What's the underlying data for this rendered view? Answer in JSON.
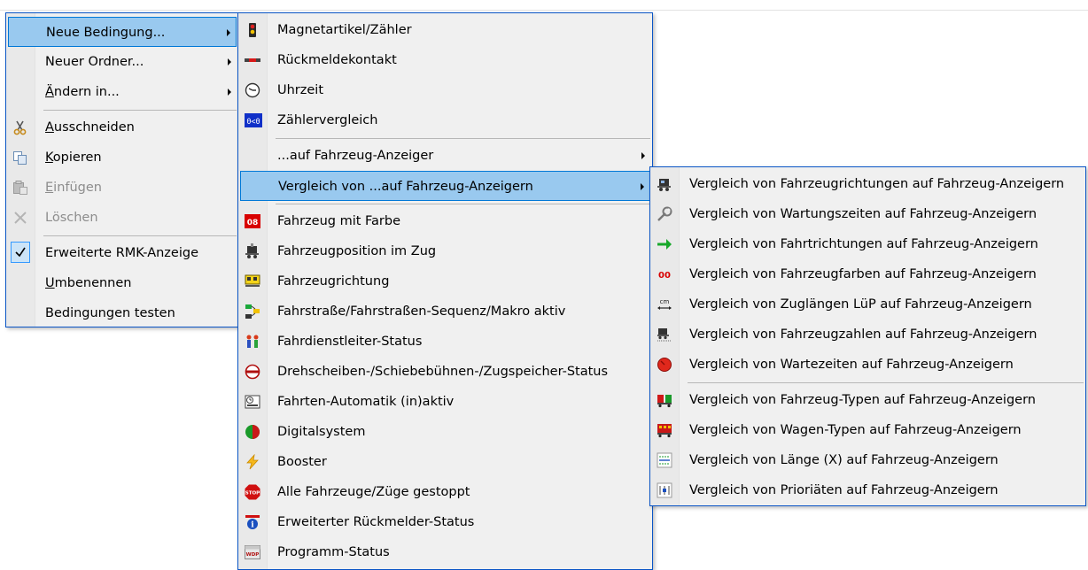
{
  "menu1": {
    "items": [
      {
        "pre": "",
        "u": "",
        "post": "Neue Bedingung...",
        "icon": "",
        "submenu": true
      },
      {
        "pre": "",
        "u": "",
        "post": "Neuer Ordner...",
        "icon": "",
        "submenu": true
      },
      {
        "pre": "",
        "u": "Ä",
        "post": "ndern in...",
        "icon": "",
        "submenu": true
      },
      {
        "pre": "",
        "u": "A",
        "post": "usschneiden",
        "icon": "scissors-icon"
      },
      {
        "pre": "",
        "u": "K",
        "post": "opieren",
        "icon": "copy-icon"
      },
      {
        "pre": "",
        "u": "E",
        "post": "infügen",
        "icon": "paste-icon",
        "disabled": true
      },
      {
        "pre": "",
        "u": "",
        "post": "Löschen",
        "icon": "delete-icon",
        "disabled": true
      },
      {
        "pre": "",
        "u": "",
        "post": "Erweiterte RMK-Anzeige",
        "icon": "checkmark-icon",
        "checked": true
      },
      {
        "pre": "",
        "u": "U",
        "post": "mbenennen",
        "icon": ""
      },
      {
        "pre": "",
        "u": "",
        "post": "Bedingungen testen",
        "icon": ""
      }
    ]
  },
  "menu2": {
    "items": [
      {
        "label": "Magnetartikel/Zähler",
        "icon": "signal-icon"
      },
      {
        "label": "Rückmeldekontakt",
        "icon": "feedback-contact-icon"
      },
      {
        "label": "Uhrzeit",
        "icon": "clock-icon"
      },
      {
        "label": "Zählervergleich",
        "icon": "counter-compare-icon"
      },
      {
        "label": "...auf Fahrzeug-Anzeiger",
        "icon": "",
        "submenu": true
      },
      {
        "label": "Vergleich von ...auf Fahrzeug-Anzeigern",
        "icon": "",
        "submenu": true
      },
      {
        "label": "Fahrzeug mit Farbe",
        "icon": "vehicle-color-icon"
      },
      {
        "label": "Fahrzeugposition im Zug",
        "icon": "vehicle-position-icon"
      },
      {
        "label": "Fahrzeugrichtung",
        "icon": "vehicle-direction-icon"
      },
      {
        "label": "Fahrstraße/Fahrstraßen-Sequenz/Makro aktiv",
        "icon": "route-icon"
      },
      {
        "label": "Fahrdienstleiter-Status",
        "icon": "dispatcher-icon"
      },
      {
        "label": "Drehscheiben-/Schiebebühnen-/Zugspeicher-Status",
        "icon": "turntable-icon"
      },
      {
        "label": "Fahrten-Automatik (in)aktiv",
        "icon": "schedule-icon"
      },
      {
        "label": "Digitalsystem",
        "icon": "digital-system-icon"
      },
      {
        "label": "Booster",
        "icon": "booster-icon"
      },
      {
        "label": "Alle Fahrzeuge/Züge gestoppt",
        "icon": "stop-icon"
      },
      {
        "label": "Erweiterter Rückmelder-Status",
        "icon": "info-icon"
      },
      {
        "label": "Programm-Status",
        "icon": "program-status-icon"
      }
    ]
  },
  "menu3": {
    "items": [
      {
        "label": "Vergleich von Fahrzeugrichtungen auf Fahrzeug-Anzeigern",
        "icon": "locomotive-direction-icon"
      },
      {
        "label": "Vergleich von Wartungszeiten auf Fahrzeug-Anzeigern",
        "icon": "wrench-icon"
      },
      {
        "label": "Vergleich von Fahrtrichtungen auf Fahrzeug-Anzeigern",
        "icon": "green-arrow-icon"
      },
      {
        "label": "Vergleich von Fahrzeugfarben auf Fahrzeug-Anzeigern",
        "icon": "color-00-icon"
      },
      {
        "label": "Vergleich von Zuglängen LüP auf Fahrzeug-Anzeigern",
        "icon": "length-cm-icon"
      },
      {
        "label": "Vergleich von Fahrzeugzahlen auf Fahrzeug-Anzeigern",
        "icon": "vehicle-count-icon"
      },
      {
        "label": "Vergleich von Wartezeiten auf Fahrzeug-Anzeigern",
        "icon": "wait-time-icon"
      },
      {
        "label": "Vergleich von Fahrzeug-Typen auf Fahrzeug-Anzeigern",
        "icon": "vehicle-type-icon"
      },
      {
        "label": "Vergleich von Wagen-Typen auf Fahrzeug-Anzeigern",
        "icon": "wagon-type-icon"
      },
      {
        "label": "Vergleich von Länge (X) auf Fahrzeug-Anzeigern",
        "icon": "length-x-icon"
      },
      {
        "label": "Vergleich von Prioriäten auf Fahrzeug-Anzeigern",
        "icon": "priority-icon"
      }
    ]
  },
  "icon_glyphs": {
    "counter_compare": "0<0",
    "vehicle_color": "08",
    "color_00": "00",
    "length_cm": "cm",
    "stop": "STOP",
    "info": "i",
    "program_status": "WDP"
  }
}
